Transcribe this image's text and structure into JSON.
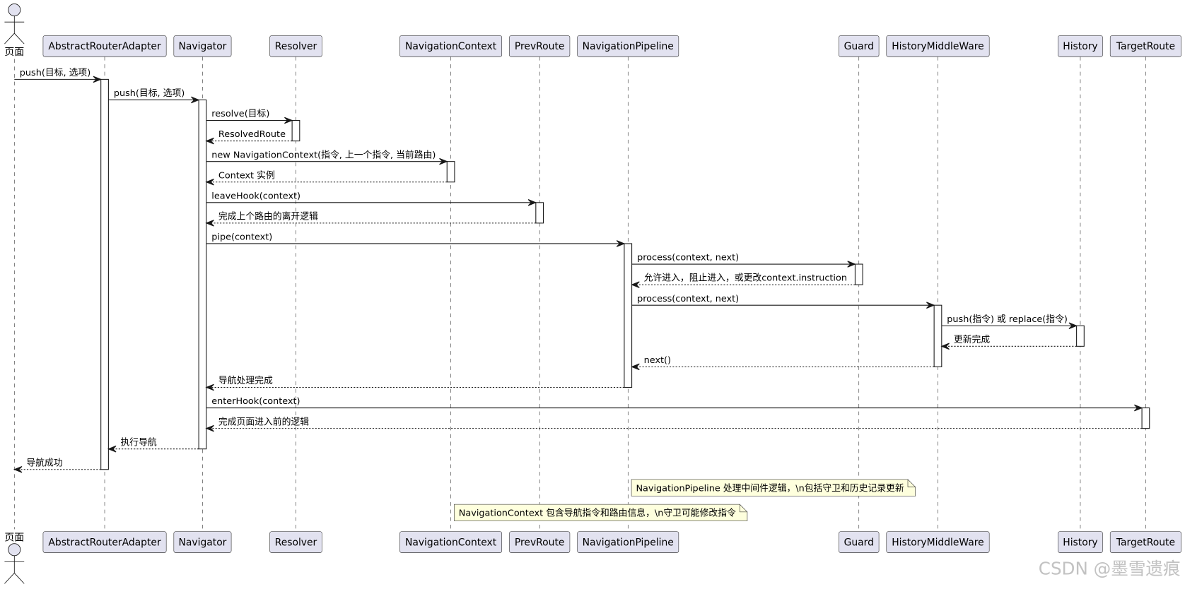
{
  "diagram": {
    "participants": [
      {
        "name": "页面",
        "actor": true
      },
      {
        "name": "AbstractRouterAdapter"
      },
      {
        "name": "Navigator"
      },
      {
        "name": "Resolver"
      },
      {
        "name": "NavigationContext"
      },
      {
        "name": "PrevRoute"
      },
      {
        "name": "NavigationPipeline"
      },
      {
        "name": "Guard"
      },
      {
        "name": "HistoryMiddleWare"
      },
      {
        "name": "History"
      },
      {
        "name": "TargetRoute"
      }
    ],
    "messages": [
      {
        "from": 0,
        "to": 1,
        "label": "push(目标, 选项)",
        "dashed": false
      },
      {
        "from": 1,
        "to": 2,
        "label": "push(目标, 选项)",
        "dashed": false
      },
      {
        "from": 2,
        "to": 3,
        "label": "resolve(目标)",
        "dashed": false
      },
      {
        "from": 3,
        "to": 2,
        "label": "ResolvedRoute",
        "dashed": true
      },
      {
        "from": 2,
        "to": 4,
        "label": "new NavigationContext(指令, 上一个指令, 当前路由)",
        "dashed": false
      },
      {
        "from": 4,
        "to": 2,
        "label": "Context 实例",
        "dashed": true
      },
      {
        "from": 2,
        "to": 5,
        "label": "leaveHook(context)",
        "dashed": false
      },
      {
        "from": 5,
        "to": 2,
        "label": "完成上个路由的离开逻辑",
        "dashed": true
      },
      {
        "from": 2,
        "to": 6,
        "label": "pipe(context)",
        "dashed": false
      },
      {
        "from": 6,
        "to": 7,
        "label": "process(context, next)",
        "dashed": false
      },
      {
        "from": 7,
        "to": 6,
        "label": "允许进入，阻止进入，或更改context.instruction",
        "dashed": true
      },
      {
        "from": 6,
        "to": 8,
        "label": "process(context, next)",
        "dashed": false
      },
      {
        "from": 8,
        "to": 9,
        "label": "push(指令) 或 replace(指令)",
        "dashed": false
      },
      {
        "from": 9,
        "to": 8,
        "label": "更新完成",
        "dashed": true
      },
      {
        "from": 8,
        "to": 6,
        "label": "next()",
        "dashed": true
      },
      {
        "from": 6,
        "to": 2,
        "label": "导航处理完成",
        "dashed": true
      },
      {
        "from": 2,
        "to": 10,
        "label": "enterHook(context)",
        "dashed": false
      },
      {
        "from": 10,
        "to": 2,
        "label": "完成页面进入前的逻辑",
        "dashed": true
      },
      {
        "from": 2,
        "to": 1,
        "label": "执行导航",
        "dashed": true
      },
      {
        "from": 1,
        "to": 0,
        "label": "导航成功",
        "dashed": true
      }
    ],
    "notes": [
      {
        "right_of": 6,
        "text": "NavigationPipeline 处理中间件逻辑，\\n包括守卫和历史记录更新"
      },
      {
        "right_of": 4,
        "text": "NavigationContext 包含导航指令和路由信息，\\n守卫可能修改指令"
      }
    ]
  },
  "watermark": "CSDN @墨雪遗痕",
  "colors": {
    "background": "#FFFFFF",
    "participant_fill": "#E2E2F0",
    "line": "#181818",
    "text": "#000000",
    "activation_fill": "#FFFFFF",
    "note_fill": "#FEFFDD",
    "watermark": "#C2C2C2"
  }
}
